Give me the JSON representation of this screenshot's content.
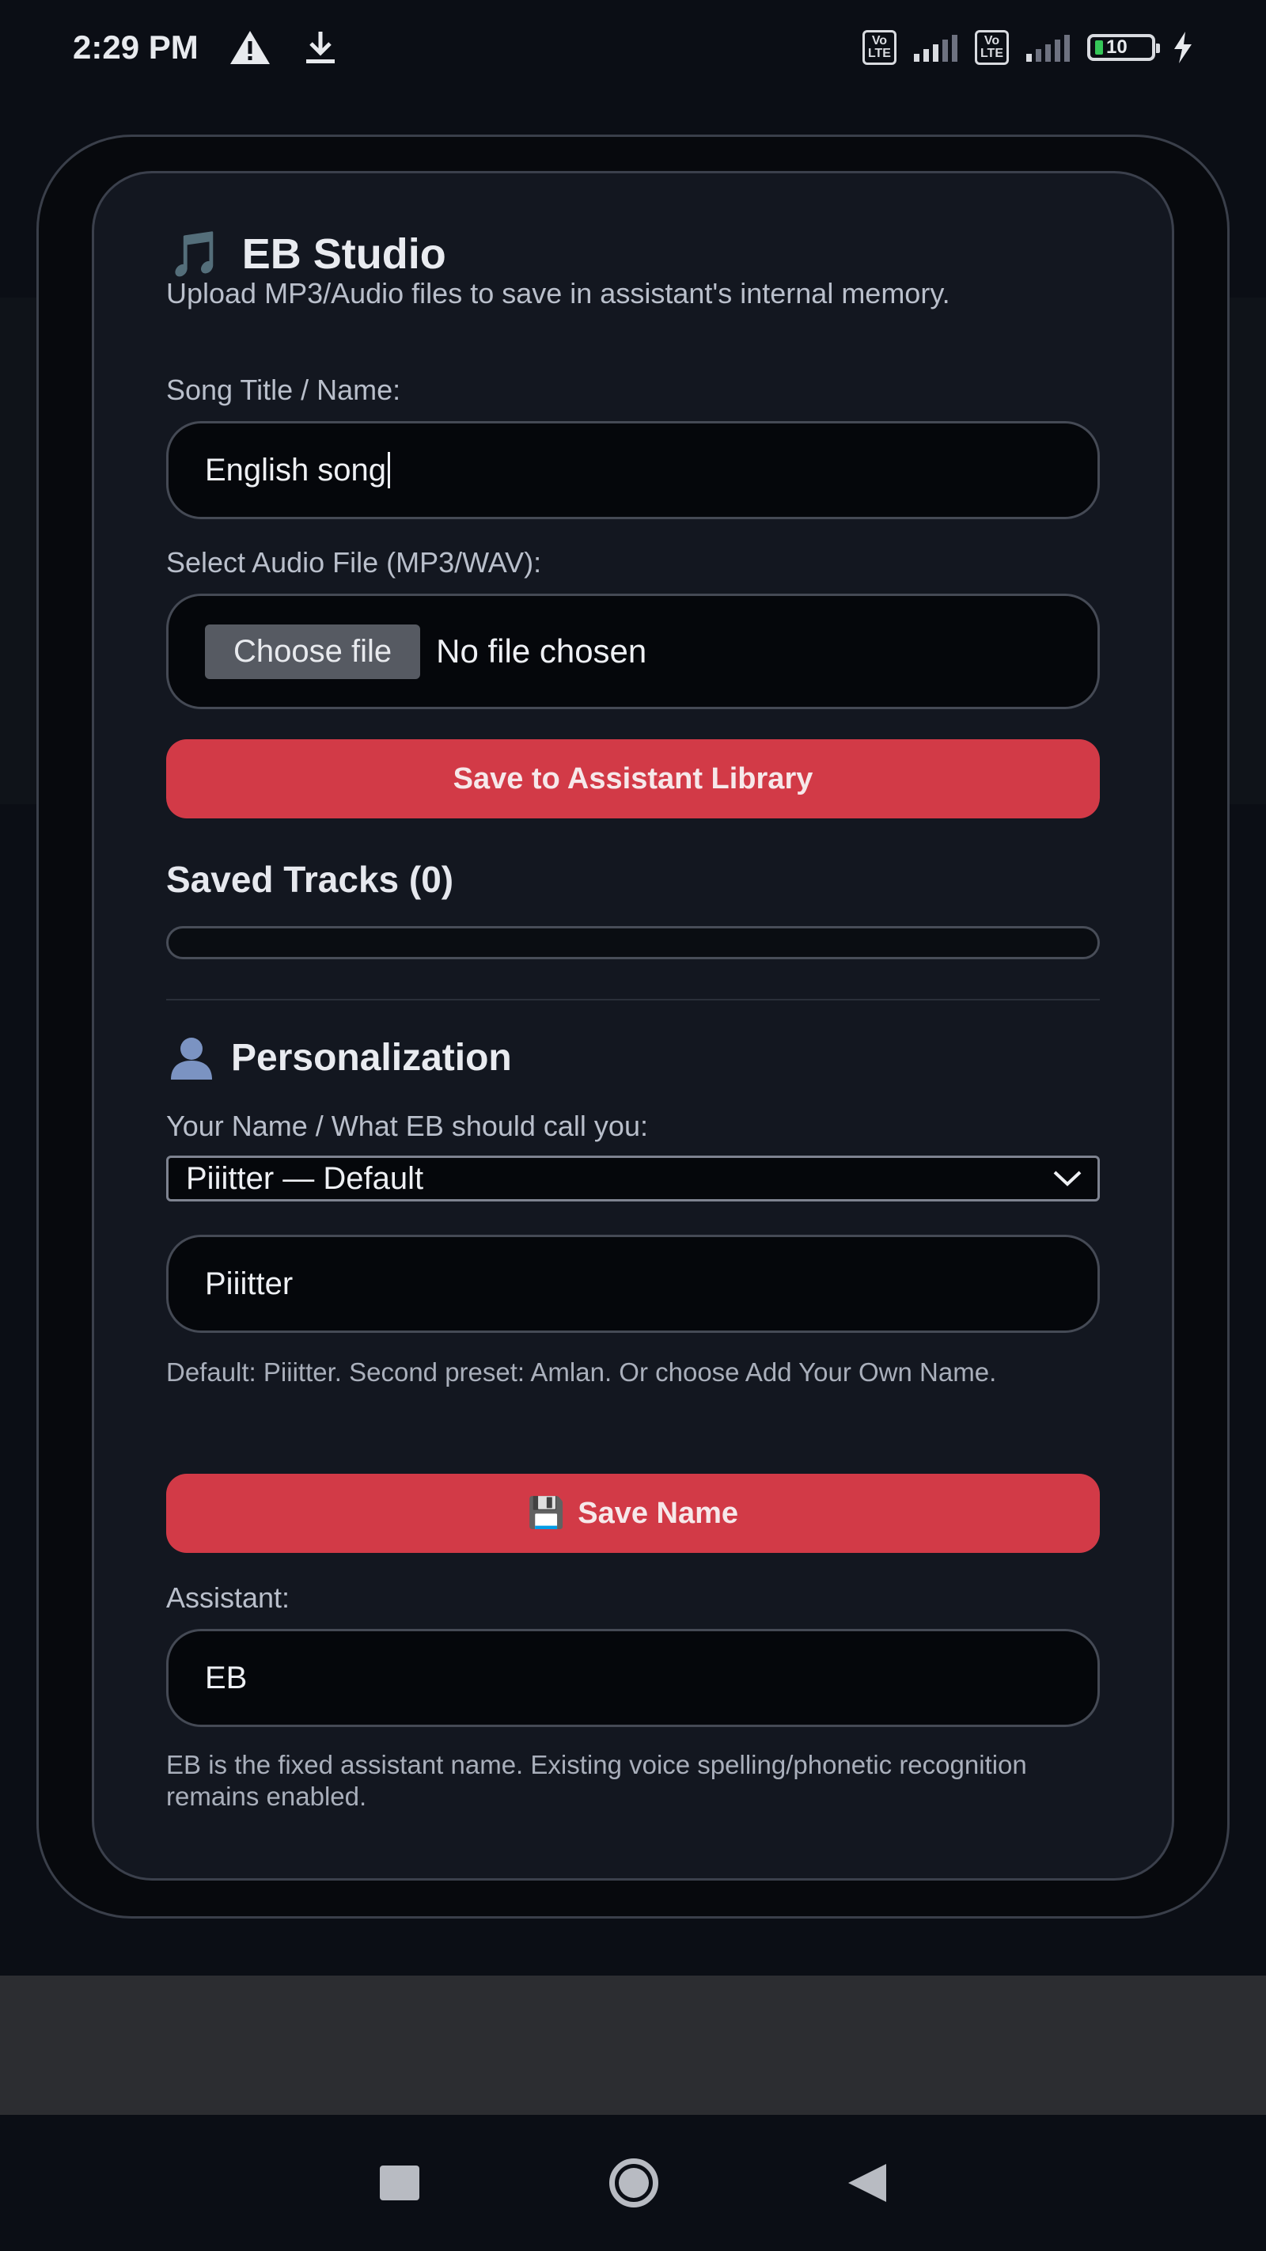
{
  "status_bar": {
    "time": "2:29 PM",
    "notification_icons": [
      "warning-icon",
      "download-icon"
    ],
    "network_label_1": "Vo\nLTE",
    "network_label_2": "Vo\nLTE",
    "battery_level": "10"
  },
  "studio": {
    "title_icon": "music-note-icon",
    "title": "EB Studio",
    "subtitle": "Upload MP3/Audio files to save in assistant's internal memory.",
    "song_title_label": "Song Title / Name:",
    "song_title_value": "English song",
    "audio_file_label": "Select Audio File (MP3/WAV):",
    "choose_file_label": "Choose file",
    "file_status": "No file chosen",
    "save_library_label": "Save to Assistant Library",
    "saved_tracks_title": "Saved Tracks (0)"
  },
  "personalization": {
    "title_icon": "user-icon",
    "title": "Personalization",
    "name_label": "Your Name / What EB should call you:",
    "name_select_value": "Piiitter — Default",
    "name_input_value": "Piiitter",
    "name_hint": "Default: Piiitter. Second preset: Amlan. Or choose Add Your Own Name.",
    "save_name_icon": "💾",
    "save_name_label": "Save Name",
    "assistant_label": "Assistant:",
    "assistant_value": "EB",
    "assistant_hint": "EB is the fixed assistant name. Existing voice spelling/phonetic recognition remains enabled."
  },
  "colors": {
    "accent_red": "#d23a47",
    "panel_bg": "#131720",
    "input_bg": "#05070b"
  }
}
